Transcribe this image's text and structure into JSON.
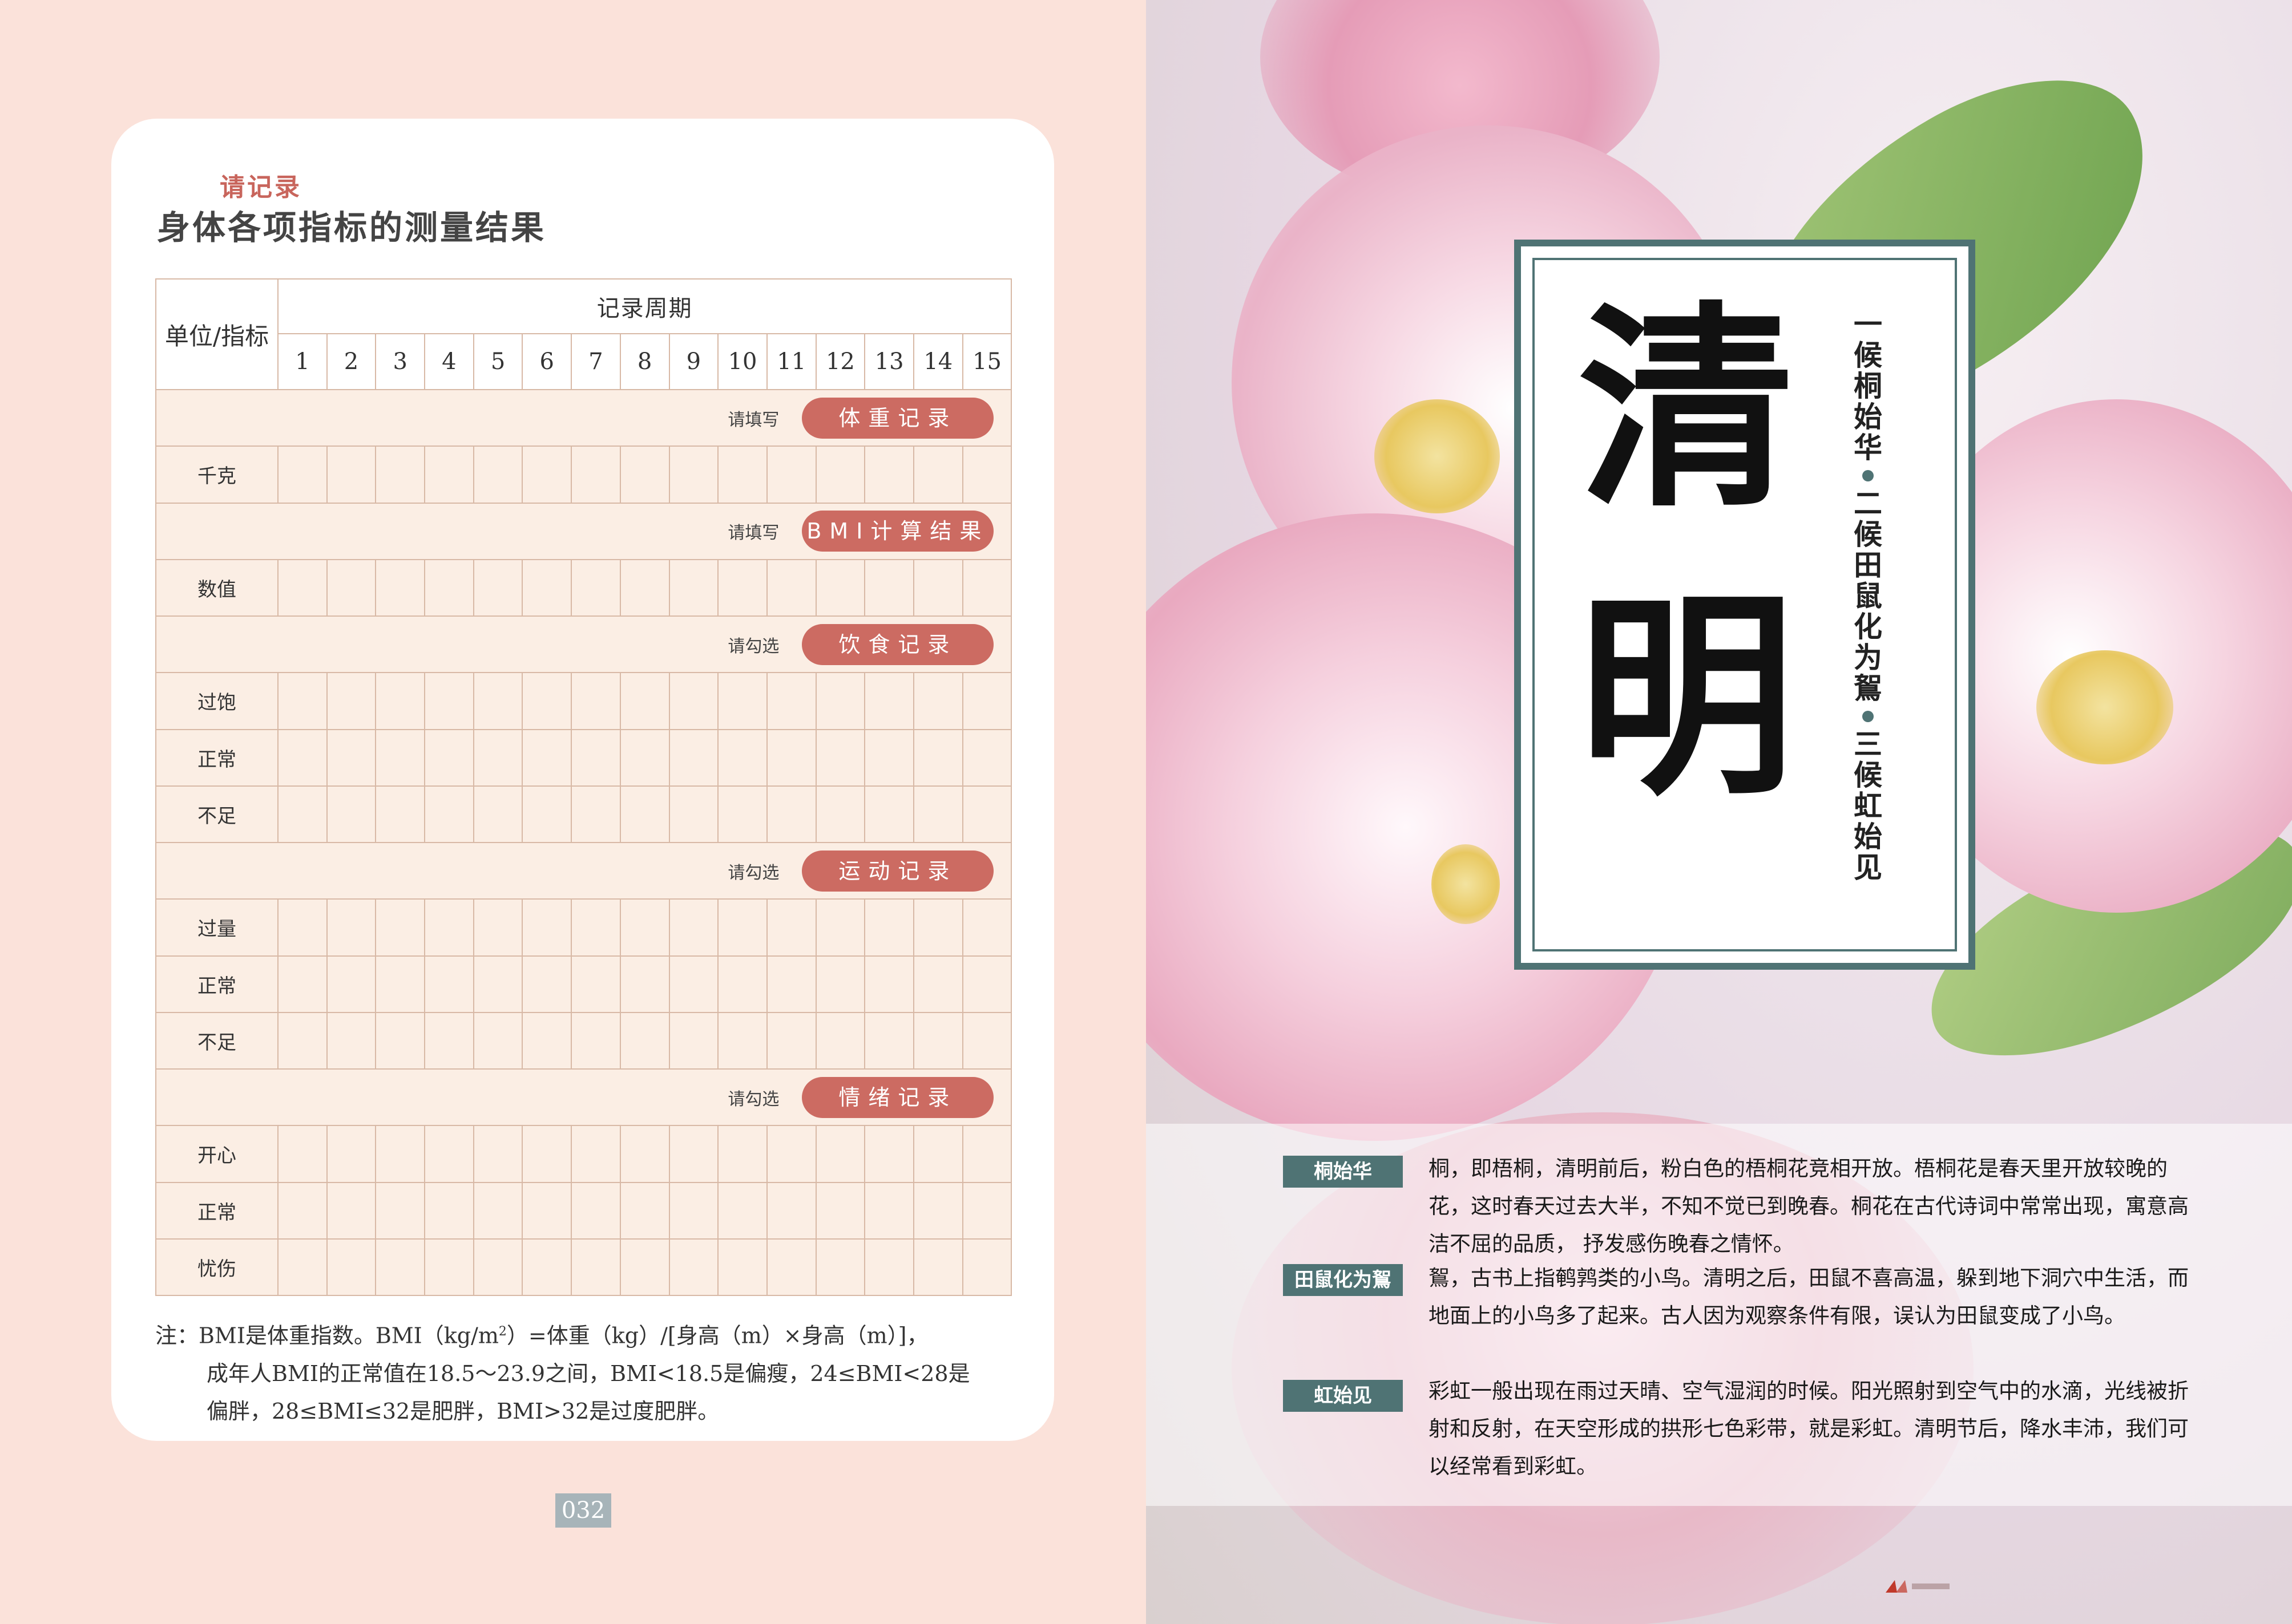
{
  "left_page": {
    "record_label": "请记录",
    "record_title": "身体各项指标的测量结果",
    "table": {
      "unit_header": "单位/指标",
      "period_header": "记录周期",
      "periods": [
        "1",
        "2",
        "3",
        "4",
        "5",
        "6",
        "7",
        "8",
        "9",
        "10",
        "11",
        "12",
        "13",
        "14",
        "15"
      ],
      "sections": [
        {
          "prompt": "请填写",
          "badge": "体重记录",
          "rows": [
            "千克"
          ]
        },
        {
          "prompt": "请填写",
          "badge": "BMI计算结果",
          "rows": [
            "数值"
          ]
        },
        {
          "prompt": "请勾选",
          "badge": "饮食记录",
          "rows": [
            "过饱",
            "正常",
            "不足"
          ]
        },
        {
          "prompt": "请勾选",
          "badge": "运动记录",
          "rows": [
            "过量",
            "正常",
            "不足"
          ]
        },
        {
          "prompt": "请勾选",
          "badge": "情绪记录",
          "rows": [
            "开心",
            "正常",
            "忧伤"
          ]
        }
      ]
    },
    "note": {
      "line1_a": "注：BMI是体重指数。BMI（kg/m",
      "line1_sup": "2",
      "line1_b": "）=体重（kg）/[身高（m）×身高（m）]，",
      "line2": "成年人BMI的正常值在18.5～23.9之间，BMI<18.5是偏瘦，24≤BMI<28是",
      "line3": "偏胖，28≤BMI≤32是肥胖，BMI>32是过度肥胖。"
    },
    "page_number": "032"
  },
  "right_page": {
    "title_char1": "清",
    "title_char2": "明",
    "candidates": [
      "一候桐始华",
      "二候田鼠化为鴽",
      "三候虹始见"
    ],
    "entries": [
      {
        "tag": "桐始华",
        "text": "桐，即梧桐，清明前后，粉白色的梧桐花竞相开放。梧桐花是春天里开放较晚的花，这时春天过去大半，不知不觉已到晚春。桐花在古代诗词中常常出现，寓意高洁不屈的品质， 抒发感伤晚春之情怀。"
      },
      {
        "tag": "田鼠化为鴽",
        "text": "鴽，古书上指鹌鹑类的小鸟。清明之后，田鼠不喜高温，躲到地下洞穴中生活，而地面上的小鸟多了起来。古人因为观察条件有限，误认为田鼠变成了小鸟。"
      },
      {
        "tag": "虹始见",
        "text": "彩虹一般出现在雨过天晴、空气湿润的时候。阳光照射到空气中的水滴，光线被折射和反射，在天空形成的拱形七色彩带，就是彩虹。清明节后，降水丰沛，我们可以经常看到彩虹。"
      }
    ]
  },
  "colors": {
    "left_bg": "#fbe2da",
    "badge": "#cc6b62",
    "accent_teal": "#4f7374",
    "table_fill": "#fbeee4",
    "grid_line": "#d8b9a6"
  }
}
